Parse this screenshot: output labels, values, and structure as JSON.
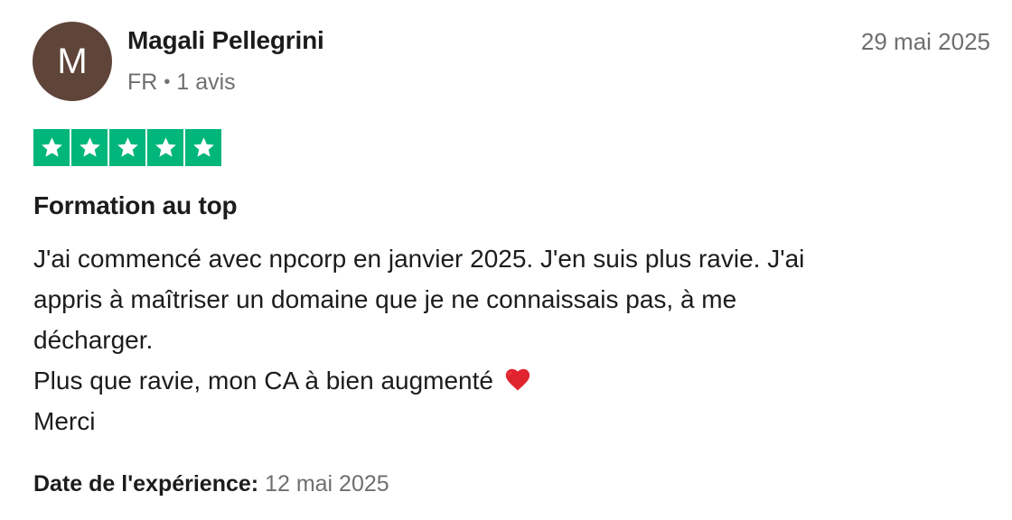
{
  "review": {
    "reviewer": {
      "avatar_initial": "M",
      "name": "Magali Pellegrini",
      "country": "FR",
      "separator": "•",
      "review_count": "1 avis"
    },
    "published_date": "29 mai 2025",
    "rating": {
      "stars": 5,
      "max_stars": 5,
      "color": "#00b67a",
      "icon": "star-icon"
    },
    "title": "Formation au top",
    "body_lines": [
      "J'ai commencé avec npcorp en janvier 2025. J'en suis plus ravie. J'ai",
      "appris à maîtriser un domaine que je ne connaissais pas, à me",
      "décharger.",
      "Plus que ravie, mon CA à bien augmenté",
      "Merci"
    ],
    "emoji": {
      "name": "red-heart-icon",
      "color": "#e0242f"
    },
    "experience": {
      "label": "Date de l'expérience:",
      "date": "12 mai 2025"
    }
  }
}
